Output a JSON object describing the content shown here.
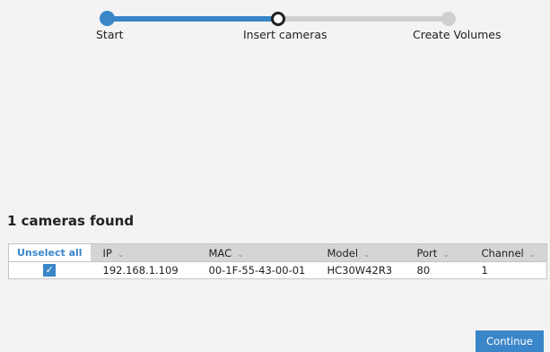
{
  "stepper": {
    "steps": [
      {
        "label": "Start",
        "state": "done"
      },
      {
        "label": "Insert cameras",
        "state": "current"
      },
      {
        "label": "Create Volumes",
        "state": "pending"
      }
    ]
  },
  "results": {
    "title": "1 cameras found"
  },
  "table": {
    "select_all_label": "Unselect all",
    "columns": [
      "IP",
      "MAC",
      "Model",
      "Port",
      "Channel"
    ],
    "rows": [
      {
        "checked": true,
        "cells": [
          "192.168.1.109",
          "00-1F-55-43-00-01",
          "HC30W42R3",
          "80",
          "1"
        ]
      }
    ]
  },
  "footer": {
    "continue_label": "Continue"
  },
  "colors": {
    "accent": "#3a86c8",
    "pending": "#cfcfcf",
    "background": "#f3f3f3"
  },
  "icons": {
    "checkbox": "checkmark-icon",
    "sort": "chevron-down-icon"
  }
}
